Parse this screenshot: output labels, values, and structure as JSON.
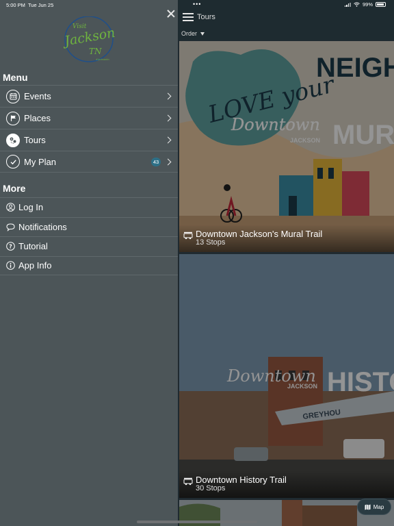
{
  "status_bar": {
    "time": "5:00 PM",
    "date": "Tue Jun 25",
    "battery": "99%"
  },
  "sidebar": {
    "logo": {
      "line1": "Visit",
      "line2": "Jackson",
      "line3": "TN",
      "tagline": "#jacksontn"
    },
    "menu_title": "Menu",
    "menu_items": [
      {
        "label": "Events",
        "icon": "calendar-icon"
      },
      {
        "label": "Places",
        "icon": "flag-icon"
      },
      {
        "label": "Tours",
        "icon": "tour-map-icon"
      },
      {
        "label": "My Plan",
        "icon": "checkmark-icon",
        "badge": "43"
      }
    ],
    "more_title": "More",
    "more_items": [
      {
        "label": "Log In",
        "icon": "user-icon"
      },
      {
        "label": "Notifications",
        "icon": "chat-bubble-icon"
      },
      {
        "label": "Tutorial",
        "icon": "question-icon"
      },
      {
        "label": "App Info",
        "icon": "info-icon"
      }
    ]
  },
  "main": {
    "title": "Tours",
    "order_label": "Order",
    "tours": [
      {
        "name": "Downtown Jackson's Mural Trail",
        "stops": "13 Stops",
        "image_text": [
          "LOVE your",
          "NEIGH",
          "Downtown",
          "JACKSON",
          "MURA"
        ]
      },
      {
        "name": "Downtown History Trail",
        "stops": "30 Stops",
        "image_text": [
          "Downtown",
          "JACKSON",
          "HISTO",
          "GREYHOU"
        ]
      }
    ],
    "map_button": "Map"
  },
  "colors": {
    "sidebar_bg": "#4c5558",
    "nav_bg": "#1e2b30",
    "logo_green": "#6fb43f",
    "logo_blue": "#1f4f8a",
    "badge": "#2d6f86"
  }
}
